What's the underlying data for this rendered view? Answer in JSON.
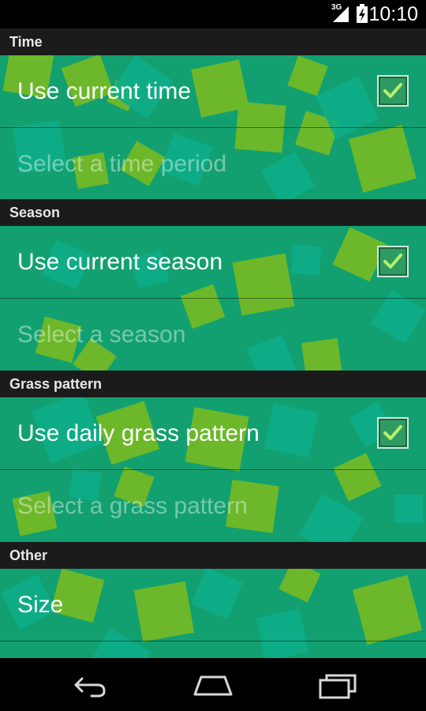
{
  "status_bar": {
    "network": "3G",
    "time": "10:10",
    "icons": [
      "signal-icon",
      "battery-charging-icon"
    ]
  },
  "sections": [
    {
      "header": "Time",
      "items": [
        {
          "label": "Use current time",
          "checked": true,
          "enabled": true
        },
        {
          "label": "Select a time period",
          "enabled": false
        }
      ]
    },
    {
      "header": "Season",
      "items": [
        {
          "label": "Use current season",
          "checked": true,
          "enabled": true
        },
        {
          "label": "Select a season",
          "enabled": false
        }
      ]
    },
    {
      "header": "Grass pattern",
      "items": [
        {
          "label": "Use daily grass pattern",
          "checked": true,
          "enabled": true
        },
        {
          "label": "Select a grass pattern",
          "enabled": false
        }
      ]
    },
    {
      "header": "Other",
      "items": [
        {
          "label": "Size",
          "enabled": true
        }
      ]
    }
  ],
  "nav_bar": {
    "buttons": [
      "back-icon",
      "home-icon",
      "recent-apps-icon"
    ]
  },
  "colors": {
    "background_green": "#12a070",
    "square_lime": "#6cb82a",
    "square_teal": "#0fa585",
    "header_bg": "#1b1b1b"
  }
}
